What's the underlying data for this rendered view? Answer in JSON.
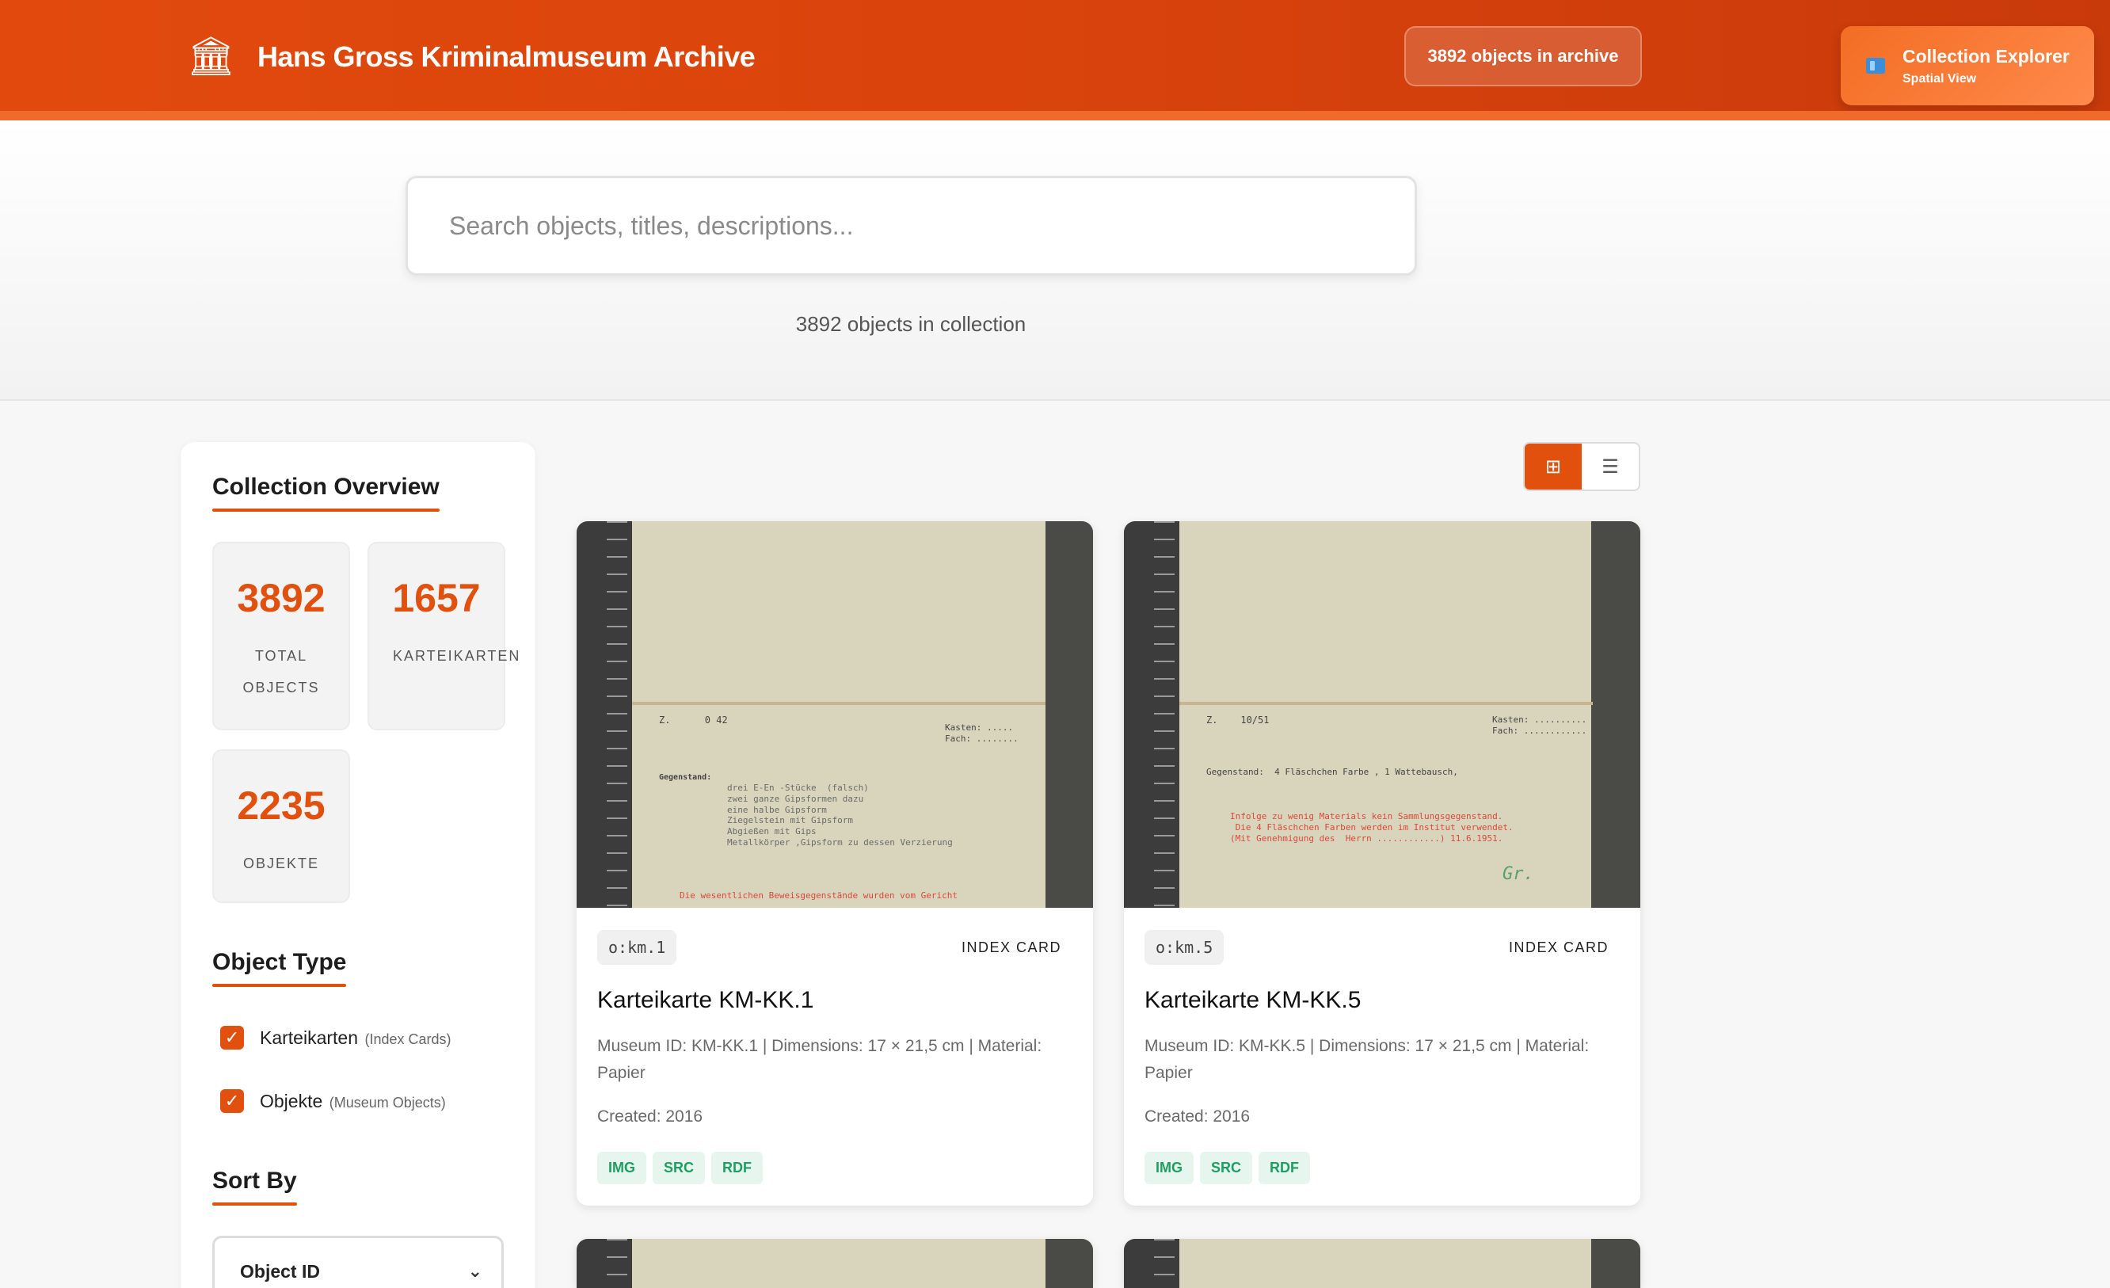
{
  "header": {
    "title": "Hans Gross Kriminalmuseum Archive",
    "logo_icon": "museum-building-icon",
    "count_pill": "3892 objects in archive",
    "explorer": {
      "title": "Collection Explorer",
      "subtitle": "Spatial View",
      "icon": "map-icon"
    }
  },
  "search": {
    "placeholder": "Search objects, titles, descriptions...",
    "count_text": "3892 objects in collection"
  },
  "sidebar": {
    "overview_title": "Collection Overview",
    "stats": [
      {
        "value": "3892",
        "label": "TOTAL OBJECTS"
      },
      {
        "value": "1657",
        "label": "KARTEIKARTEN"
      },
      {
        "value": "2235",
        "label": "OBJEKTE"
      }
    ],
    "object_type_title": "Object Type",
    "object_types": [
      {
        "label": "Karteikarten",
        "sub": "(Index Cards)",
        "checked": true
      },
      {
        "label": "Objekte",
        "sub": "(Museum Objects)",
        "checked": true
      }
    ],
    "sort_title": "Sort By",
    "sort_value": "Object ID"
  },
  "view_toggle": {
    "active": "grid",
    "grid_icon": "grid-icon",
    "list_icon": "list-icon"
  },
  "cards": [
    {
      "id": "o:km.1",
      "type": "INDEX CARD",
      "title": "Karteikarte KM-KK.1",
      "description": "Museum ID: KM-KK.1 | Dimensions: 17 × 21,5 cm | Material: Papier",
      "created": "Created: 2016",
      "badges": [
        "IMG",
        "SRC",
        "RDF"
      ]
    },
    {
      "id": "o:km.5",
      "type": "INDEX CARD",
      "title": "Karteikarte KM-KK.5",
      "description": "Museum ID: KM-KK.5 | Dimensions: 17 × 21,5 cm | Material: Papier",
      "created": "Created: 2016",
      "badges": [
        "IMG",
        "SRC",
        "RDF"
      ]
    }
  ],
  "colors": {
    "accent": "#e2500e",
    "header": "#d9430c",
    "badge_text": "#1e9e60",
    "badge_bg": "#e6f6ee"
  }
}
